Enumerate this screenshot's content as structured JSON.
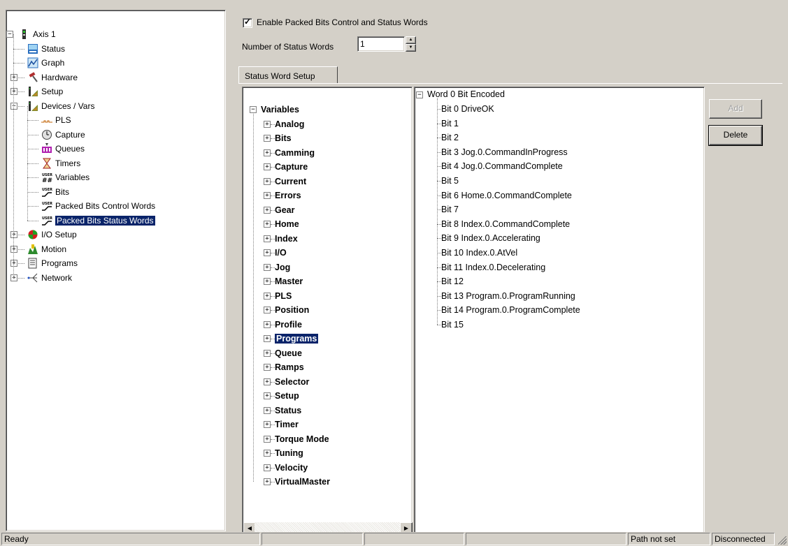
{
  "left_tree": {
    "items": [
      {
        "label": "Axis 1",
        "depth": 0,
        "expander": "minus",
        "icon": "axis-icon"
      },
      {
        "label": "Status",
        "depth": 1,
        "expander": "",
        "icon": "status-icon"
      },
      {
        "label": "Graph",
        "depth": 1,
        "expander": "",
        "icon": "graph-icon"
      },
      {
        "label": "Hardware",
        "depth": 1,
        "expander": "plus",
        "icon": "hammer-icon"
      },
      {
        "label": "Setup",
        "depth": 1,
        "expander": "plus",
        "icon": "setup-icon"
      },
      {
        "label": "Devices / Vars",
        "depth": 1,
        "expander": "minus",
        "icon": "devices-icon"
      },
      {
        "label": "PLS",
        "depth": 2,
        "expander": "",
        "icon": "pls-icon"
      },
      {
        "label": "Capture",
        "depth": 2,
        "expander": "",
        "icon": "clock-icon"
      },
      {
        "label": "Queues",
        "depth": 2,
        "expander": "",
        "icon": "queue-icon"
      },
      {
        "label": "Timers",
        "depth": 2,
        "expander": "",
        "icon": "hourglass-icon"
      },
      {
        "label": "Variables",
        "depth": 2,
        "expander": "",
        "icon": "user-variables-icon"
      },
      {
        "label": "Bits",
        "depth": 2,
        "expander": "",
        "icon": "user-bits-icon"
      },
      {
        "label": "Packed Bits Control Words",
        "depth": 2,
        "expander": "",
        "icon": "user-bits-icon"
      },
      {
        "label": "Packed Bits Status Words",
        "depth": 2,
        "expander": "",
        "icon": "user-bits-icon",
        "selected": true
      },
      {
        "label": "I/O Setup",
        "depth": 1,
        "expander": "plus",
        "icon": "io-icon"
      },
      {
        "label": "Motion",
        "depth": 1,
        "expander": "plus",
        "icon": "motion-icon"
      },
      {
        "label": "Programs",
        "depth": 1,
        "expander": "plus",
        "icon": "programs-icon"
      },
      {
        "label": "Network",
        "depth": 1,
        "expander": "plus",
        "icon": "network-icon"
      }
    ]
  },
  "header": {
    "enable_checked": true,
    "enable_label": "Enable Packed Bits Control and Status Words",
    "num_label": "Number of Status Words",
    "num_value": "1"
  },
  "tab_label": "Status Word Setup",
  "variables": {
    "root": "Variables",
    "items": [
      "Analog",
      "Bits",
      "Camming",
      "Capture",
      "Current",
      "Errors",
      "Gear",
      "Home",
      "Index",
      "I/O",
      "Jog",
      "Master",
      "PLS",
      "Position",
      "Profile",
      "Programs",
      "Queue",
      "Ramps",
      "Selector",
      "Setup",
      "Status",
      "Timer",
      "Torque Mode",
      "Tuning",
      "Velocity",
      "VirtualMaster"
    ],
    "selected": "Programs"
  },
  "word": {
    "root": "Word 0  Bit Encoded",
    "bits": [
      "Bit 0  DriveOK",
      "Bit 1",
      "Bit 2",
      "Bit 3  Jog.0.CommandInProgress",
      "Bit 4  Jog.0.CommandComplete",
      "Bit 5",
      "Bit 6  Home.0.CommandComplete",
      "Bit 7",
      "Bit 8  Index.0.CommandComplete",
      "Bit 9  Index.0.Accelerating",
      "Bit 10  Index.0.AtVel",
      "Bit 11  Index.0.Decelerating",
      "Bit 12",
      "Bit 13  Program.0.ProgramRunning",
      "Bit 14  Program.0.ProgramComplete",
      "Bit 15"
    ]
  },
  "buttons": {
    "add": "Add",
    "delete": "Delete",
    "add_enabled": false
  },
  "status_bar": {
    "ready": "Ready",
    "pane2": "",
    "pane3": "",
    "pane4": "",
    "path": "Path not set",
    "connection": "Disconnected"
  },
  "colors": {
    "selection": "#0a246a",
    "face": "#d4d0c8"
  }
}
